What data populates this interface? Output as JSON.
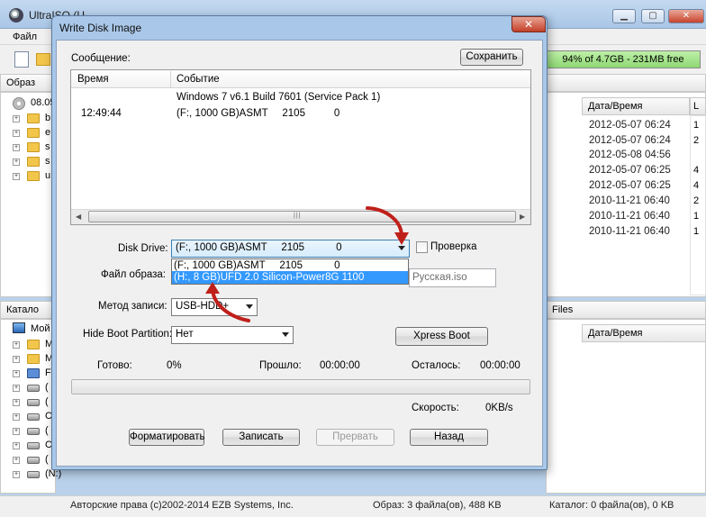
{
  "main_window": {
    "title": "UltraISO (U...",
    "menu": [
      "Файл"
    ],
    "capacity_text": "94% of 4.7GB - 231MB free",
    "image_pane_header": "Образ",
    "image_tree_root": "08.05",
    "image_tree_items": [
      "b",
      "e",
      "s",
      "s",
      "u"
    ],
    "file_list_header_date": "Дата/Время",
    "file_list_header_extra": "L",
    "file_dates": [
      "2012-05-07 06:24",
      "2012-05-07 06:24",
      "2012-05-08 04:56",
      "2012-05-07 06:25",
      "2012-05-07 06:25",
      "2010-11-21 06:40",
      "2010-11-21 06:40",
      "2010-11-21 06:40"
    ],
    "file_sizes_partial": [
      "1",
      "2",
      "",
      "4",
      "4",
      "2",
      "1",
      "1"
    ],
    "catalog_pane_header": "Катало",
    "catalog_files_header": "Files",
    "catalog_date_header": "Дата/Время",
    "catalog_tree_root": "Мой",
    "catalog_tree_items": [
      "M",
      "M",
      "F",
      "(",
      "(",
      "C",
      "(",
      "C",
      "(",
      "(N:)"
    ],
    "status_copyright": "Авторские права (c)2002-2014 EZB Systems, Inc.",
    "status_image": "Образ: 3 файла(ов), 488 KB",
    "status_catalog": "Каталог: 0 файла(ов), 0 KB"
  },
  "dialog": {
    "title": "Write Disk Image",
    "close_glyph": "✕",
    "message_label": "Сообщение:",
    "save_button": "Сохранить",
    "log_columns": [
      "Время",
      "Событие"
    ],
    "log_rows": [
      {
        "time": "",
        "event": "Windows 7 v6.1 Build 7601 (Service Pack 1)"
      },
      {
        "time": "12:49:44",
        "event": "(F:, 1000 GB)ASMT     2105          0"
      }
    ],
    "disk_drive_label": "Disk Drive:",
    "disk_drive_value": "(F:, 1000 GB)ASMT     2105           0",
    "dropdown_options": [
      "(F:, 1000 GB)ASMT     2105           0",
      "(H:, 8 GB)UFD 2.0 Silicon-Power8G 1100"
    ],
    "dropdown_selected_index": 1,
    "verify_label": "Проверка",
    "verify_checked": false,
    "image_file_label": "Файл образа:",
    "image_file_value": "Русская.iso",
    "write_method_label": "Метод записи:",
    "write_method_value": "USB-HDD+",
    "hide_boot_label": "Hide Boot Partition:",
    "hide_boot_value": "Нет",
    "xpress_boot_button": "Xpress Boot",
    "done_label": "Готово:",
    "done_value": "0%",
    "elapsed_label": "Прошло:",
    "elapsed_value": "00:00:00",
    "remaining_label": "Осталось:",
    "remaining_value": "00:00:00",
    "progress_fraction": 0.0,
    "speed_label": "Скорость:",
    "speed_value": "0KB/s",
    "format_button": "Форматировать",
    "write_button": "Записать",
    "abort_button": "Прервать",
    "back_button": "Назад"
  },
  "colors": {
    "selection": "#3399ff",
    "annotation_arrow": "#c0201a",
    "dialog_frame": "#a9c7e8",
    "capacity_fill": "#8fd874"
  }
}
